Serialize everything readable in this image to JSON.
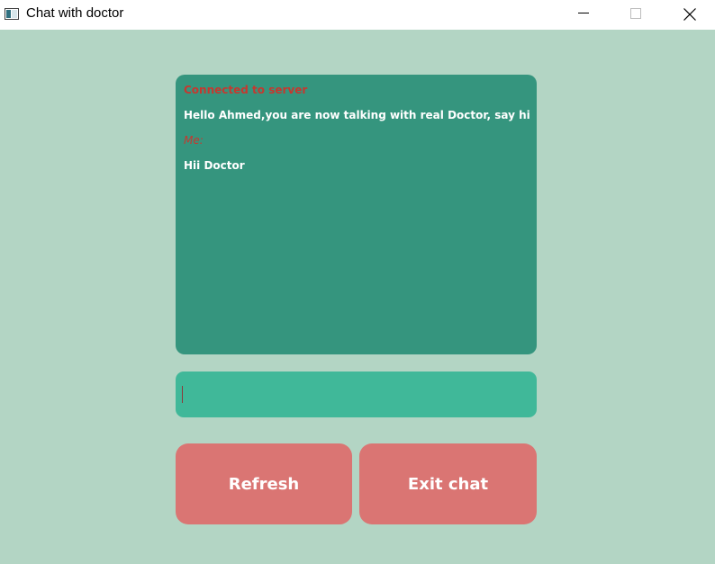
{
  "window": {
    "title": "Chat with doctor",
    "icons": {
      "app": "app-window-icon",
      "minimize": "minimize-icon",
      "maximize": "maximize-icon",
      "close": "close-icon"
    }
  },
  "chat": {
    "messages": [
      {
        "kind": "status",
        "text": "Connected to server"
      },
      {
        "kind": "text",
        "text": "Hello Ahmed,you are now talking with real Doctor, say hi"
      },
      {
        "kind": "me",
        "text": "Me:"
      },
      {
        "kind": "text",
        "text": "Hii Doctor"
      }
    ]
  },
  "input": {
    "value": "",
    "placeholder": ""
  },
  "buttons": {
    "refresh_label": "Refresh",
    "exit_label": "Exit chat"
  },
  "colors": {
    "background": "#b3d5c4",
    "chat_box": "#35957e",
    "input": "#40b899",
    "button": "#da7573",
    "status_text": "#c6382f",
    "message_text": "#ffffff"
  }
}
